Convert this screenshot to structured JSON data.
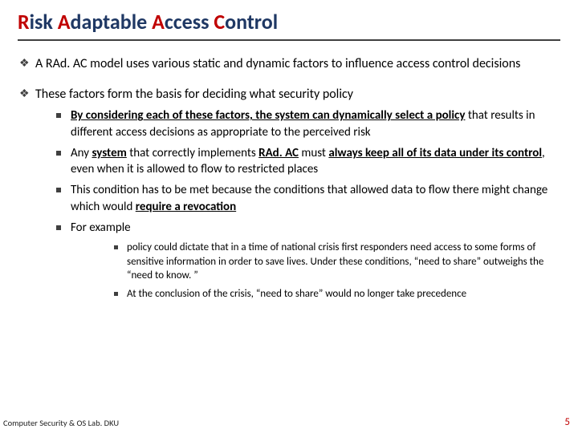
{
  "title": {
    "r": "R",
    "isk": "isk ",
    "a": "A",
    "daptable": "daptable ",
    "a2": "A",
    "ccess": "ccess ",
    "c": "C",
    "ontrol": "ontrol"
  },
  "b1": "A RAd. AC model uses various static and dynamic factors to influence access control decisions",
  "b2": "These factors form the basis for deciding what security policy",
  "s1_a": "By considering each of these factors, the system can dynamically select a policy",
  "s1_b": " that results in different access decisions as appropriate to the perceived risk",
  "s2_a": "Any ",
  "s2_b": "system",
  "s2_c": " that correctly implements ",
  "s2_d": "RAd. AC",
  "s2_e": " must ",
  "s2_f": "always keep all of its data under its control",
  "s2_g": ", even when it is allowed to flow to restricted places",
  "s3_a": "This condition has to be met because the conditions that allowed data to flow there might change which would ",
  "s3_b": "require a revocation",
  "s4": "For example",
  "t1": "policy could dictate that in a time of national crisis first responders need access to some forms of sensitive information in order to save lives. Under these conditions, “need to share” outweighs the “need to know. ”",
  "t2": "At the conclusion of the crisis, “need to share” would no longer take precedence",
  "footer": "Computer Security & OS Lab. DKU",
  "page": "5"
}
